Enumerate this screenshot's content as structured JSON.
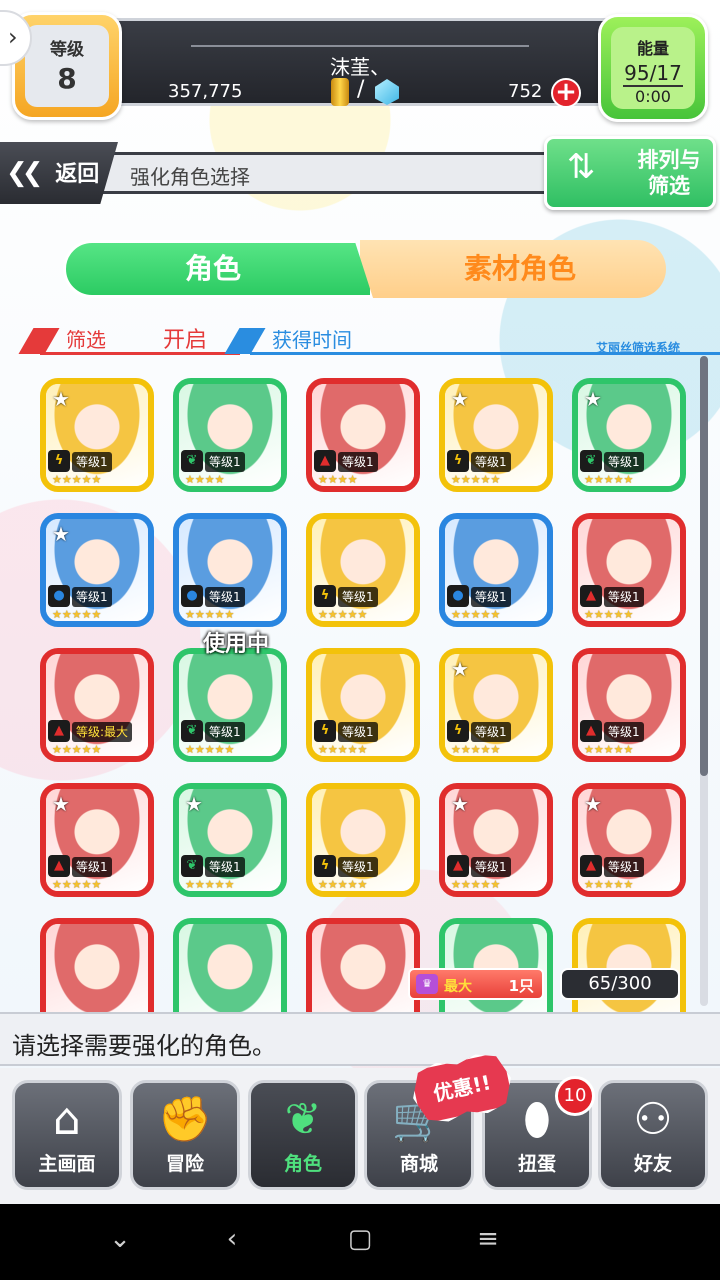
{
  "player": {
    "level_label": "等级",
    "level": "8",
    "name": "沫茥、",
    "coins": "357,775",
    "gems": "752",
    "energy_label": "能量",
    "energy": "95/17",
    "energy_timer": "0:00"
  },
  "subheader": {
    "back_label": "返回",
    "title": "强化角色选择",
    "sort_filter_label": "排列与筛选"
  },
  "tabs": [
    {
      "label": "角色",
      "active": true
    },
    {
      "label": "素材角色",
      "active": false
    }
  ],
  "filter": {
    "label": "筛选",
    "state": "开启",
    "sort_label": "获得时间",
    "system_label": "艾丽丝筛选系统"
  },
  "colors": {
    "yellow": "#f3c20a",
    "green": "#2ec56a",
    "red": "#e02d2d",
    "blue": "#2a86e0"
  },
  "cards": [
    {
      "element": "y",
      "level": "等级1",
      "stars": "★★★★★",
      "starred": true
    },
    {
      "element": "g",
      "level": "等级1",
      "stars": "★★★★",
      "starred": false
    },
    {
      "element": "r",
      "level": "等级1",
      "stars": "★★★★",
      "starred": false
    },
    {
      "element": "y",
      "level": "等级1",
      "stars": "★★★★★",
      "starred": true
    },
    {
      "element": "g",
      "level": "等级1",
      "stars": "★★★★★",
      "starred": true
    },
    {
      "element": "b",
      "level": "等级1",
      "stars": "★★★★★",
      "starred": true
    },
    {
      "element": "b",
      "level": "等级1",
      "stars": "★★★★★",
      "starred": false
    },
    {
      "element": "y",
      "level": "等级1",
      "stars": "★★★★★",
      "starred": false
    },
    {
      "element": "b",
      "level": "等级1",
      "stars": "★★★★★",
      "starred": false
    },
    {
      "element": "r",
      "level": "等级1",
      "stars": "★★★★★",
      "starred": false
    },
    {
      "element": "r",
      "level": "等级:最大",
      "stars": "★★★★★",
      "starred": false
    },
    {
      "element": "g",
      "level": "等级1",
      "stars": "★★★★★",
      "starred": false,
      "in_use": "使用中"
    },
    {
      "element": "y",
      "level": "等级1",
      "stars": "★★★★★",
      "starred": false
    },
    {
      "element": "y",
      "level": "等级1",
      "stars": "★★★★★",
      "starred": true
    },
    {
      "element": "r",
      "level": "等级1",
      "stars": "★★★★★",
      "starred": false
    },
    {
      "element": "r",
      "level": "等级1",
      "stars": "★★★★★",
      "starred": true
    },
    {
      "element": "g",
      "level": "等级1",
      "stars": "★★★★★",
      "starred": true
    },
    {
      "element": "y",
      "level": "等级1",
      "stars": "★★★★★",
      "starred": false
    },
    {
      "element": "r",
      "level": "等级1",
      "stars": "★★★★★",
      "starred": true
    },
    {
      "element": "r",
      "level": "等级1",
      "stars": "★★★★★",
      "starred": true
    },
    {
      "element": "r",
      "level": "",
      "stars": "",
      "starred": false
    },
    {
      "element": "g",
      "level": "",
      "stars": "",
      "starred": false
    },
    {
      "element": "r",
      "level": "",
      "stars": "",
      "starred": false
    },
    {
      "element": "g",
      "level": "",
      "stars": "",
      "starred": false
    },
    {
      "element": "y",
      "level": "",
      "stars": "",
      "starred": false
    }
  ],
  "capacity": {
    "max_tag": "最大",
    "max_count": "1只",
    "count": "65/300"
  },
  "message": "请选择需要强化的角色。",
  "nav": [
    {
      "label": "主画面",
      "icon": "home-icon",
      "glyph": "⌂"
    },
    {
      "label": "冒险",
      "icon": "handshake-icon",
      "glyph": "✊"
    },
    {
      "label": "角色",
      "icon": "character-icon",
      "glyph": "❦",
      "active": true
    },
    {
      "label": "商城",
      "icon": "cart-icon",
      "glyph": "🛒"
    },
    {
      "label": "扭蛋",
      "icon": "egg-icon",
      "glyph": "⬮"
    },
    {
      "label": "好友",
      "icon": "friends-icon",
      "glyph": "⚇"
    }
  ],
  "promo_label": "优惠!!",
  "gacha_badge": "10",
  "system_nav": [
    "chevron-down-icon",
    "back-icon",
    "home-square-icon",
    "menu-icon"
  ]
}
